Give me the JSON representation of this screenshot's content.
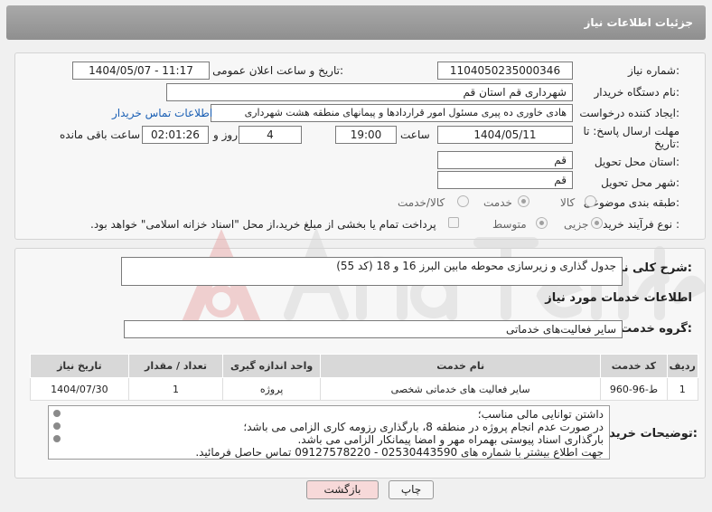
{
  "header": {
    "title": "جزئیات اطلاعات نیاز"
  },
  "form": {
    "need_number": {
      "label": "شماره نیاز:",
      "value": "1104050235000346"
    },
    "announce_datetime": {
      "label": "تاریخ و ساعت اعلان عمومی:",
      "value": "1404/05/07 - 11:17"
    },
    "buyer_org": {
      "label": "نام دستگاه خریدار:",
      "value": "شهرداری قم استان قم"
    },
    "requester": {
      "label": "ایجاد کننده درخواست:",
      "value": "هادی خاوری ده پیری مسئول امور قراردادها و پیمانهای منطقه هشت شهرداری",
      "contact_link": "اطلاعات تماس خریدار"
    },
    "deadline": {
      "label_line1": "مهلت ارسال پاسخ: تا",
      "label_line2": "تاریخ:",
      "date": "1404/05/11",
      "time_label": "ساعت",
      "time": "19:00",
      "days": "4",
      "days_label": "روز و",
      "remaining": "02:01:26",
      "remaining_label": "ساعت باقی مانده"
    },
    "delivery_province": {
      "label": "استان محل تحویل:",
      "value": "قم"
    },
    "delivery_city": {
      "label": "شهر محل تحویل:",
      "value": "قم"
    },
    "category": {
      "label": "طبقه بندی موضوعی:",
      "options": [
        "کالا",
        "خدمت",
        "کالا/خدمت"
      ],
      "selected": "خدمت"
    },
    "process_type": {
      "label": "نوع فرآیند خرید :",
      "options": [
        "جزیی",
        "متوسط"
      ],
      "selected": "جزیی",
      "payment_note": "پرداخت تمام یا بخشی از مبلغ خرید،از محل \"اسناد خزانه اسلامی\" خواهد بود."
    }
  },
  "summary": {
    "label": "شرح کلی نیاز:",
    "value": "جدول گذاری و زیرسازی محوطه مابین البرز 16 و 18 (کد 55)"
  },
  "services_section": {
    "title": "اطلاعات خدمات مورد نیاز"
  },
  "service_group": {
    "label": "گروه خدمت:",
    "value": "سایر فعالیت‌های خدماتی"
  },
  "table": {
    "headers": [
      "ردیف",
      "کد خدمت",
      "نام خدمت",
      "واحد اندازه گیری",
      "تعداد / مقدار",
      "تاریخ نیاز"
    ],
    "rows": [
      [
        "1",
        "ط-96-960",
        "سایر فعالیت های خدماتی شخصی",
        "پروژه",
        "1",
        "1404/07/30"
      ]
    ]
  },
  "buyer_notes": {
    "label": "توضیحات خریدار:",
    "lines": [
      "داشتن توانایی مالی مناسب؛",
      "در صورت عدم انجام پروژه در منطقه 8، بارگذاری رزومه کاری الزامی می باشد؛",
      "بارگذاری اسناد پیوستی بهمراه مهر و امضا پیمانکار الزامی می باشد.",
      "جهت اطلاع بیشتر با شماره های 02530443590 - 09127578220 تماس حاصل فرمائید."
    ]
  },
  "buttons": {
    "print": "چاپ",
    "back": "بازگشت"
  },
  "colors": {
    "header": "#999999",
    "link": "#1a5fb4",
    "back_button": "#f7d9d9"
  }
}
